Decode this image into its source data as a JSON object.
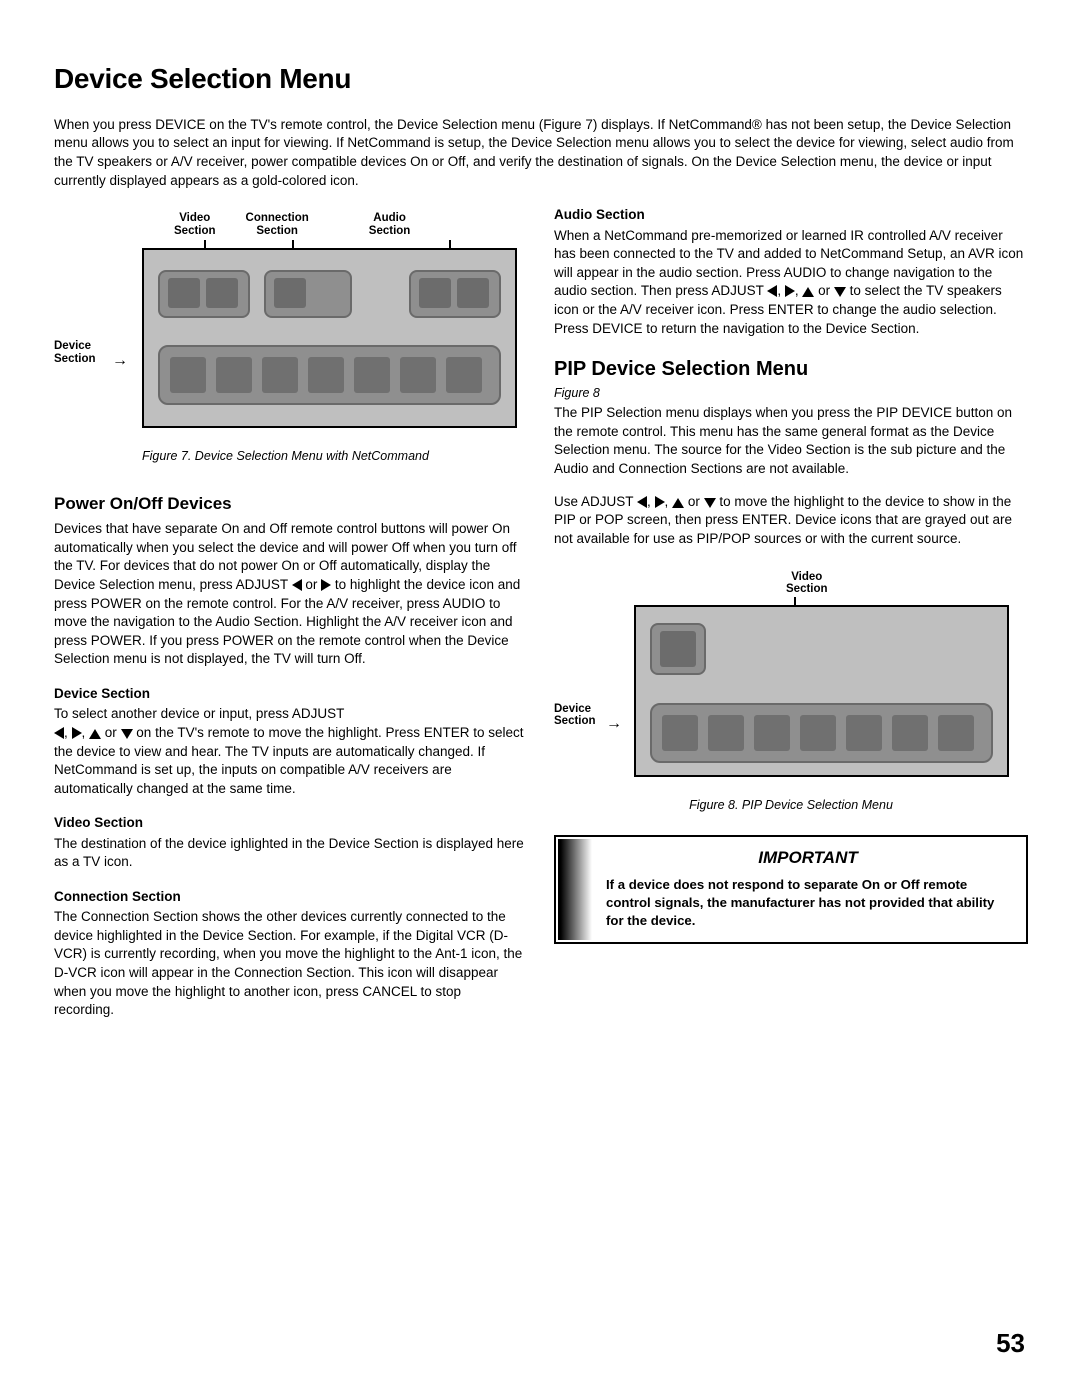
{
  "page_title": "Device Selection Menu",
  "intro": "When you press DEVICE on the TV's remote control, the Device Selection menu (Figure 7) displays.  If NetCommand® has not been setup, the Device Selection menu allows you to select an input for viewing.  If NetCommand is setup, the Device Selection menu allows you to select the device for viewing, select audio from the TV speakers or A/V receiver, power compatible devices On or Off, and verify the destination of signals. On the Device Selection menu, the device or input currently displayed appears as a gold-colored icon.",
  "fig7": {
    "label_video": "Video\nSection",
    "label_conn": "Connection\nSection",
    "label_audio": "Audio\nSection",
    "label_device": "Device\nSection",
    "caption": "Figure 7. Device Selection Menu with NetCommand"
  },
  "left": {
    "power_heading": "Power On/Off Devices",
    "power_body_a": "Devices that have separate On and Off remote control buttons will power On automatically when you select the device and will power Off when you turn off the TV.  For devices that do not power On or Off automatically, display the Device Selection menu, press ADJUST ",
    "power_body_b": " or ",
    "power_body_c": "  to highlight the device icon and press POWER on the remote control.  For the A/V receiver, press AUDIO to move the navigation to the Audio Section.  Highlight the  A/V receiver icon and press POWER.  If you press POWER on the remote control when the Device Selection menu is not displayed, the TV will turn Off.",
    "device_heading": "Device Section",
    "device_body_a": "To select another device or input, press ADJUST ",
    "device_body_b": " on the TV's remote to move the highlight.  Press ENTER to select the device to view and hear.  The TV inputs are automatically changed.  If NetCommand is set up, the inputs on compatible A/V receivers are automatically changed at the same time.",
    "video_heading": "Video Section",
    "video_body": "The destination of the device ighlighted in the Device Section is displayed here as a TV icon.",
    "conn_heading": "Connection Section",
    "conn_body": "The Connection Section shows the other devices currently connected to the device highlighted in the Device Section.  For example, if the Digital VCR (D-VCR) is currently recording, when you move the highlight to the Ant-1 icon, the D-VCR icon will appear in the Connection Section.  This icon will disappear when you move the highlight to another icon, press CANCEL to stop recording."
  },
  "right": {
    "audio_heading": "Audio Section",
    "audio_body_a": "When a NetCommand pre-memorized or learned IR controlled A/V receiver has been connected to the TV and added to NetCommand Setup, an AVR icon will appear in the audio section.  Press AUDIO  to change navigation to the audio section.  Then press ADJUST ",
    "audio_body_b": " to select the TV speakers icon or the A/V receiver icon.  Press ENTER to change the audio selection.  Press DEVICE to return the navigation to the Device Section.",
    "pip_heading": "PIP Device Selection Menu",
    "figure8_ref": "Figure 8",
    "pip_body1": "The PIP Selection menu displays when you press the PIP DEVICE button on the remote control.  This menu has the same general format as the Device Selection menu.  The source for the Video Section is the sub picture and the Audio and Connection Sections are not available.",
    "pip_body2_a": "Use ADJUST ",
    "pip_body2_b": "  to move the highlight to the device to show in the PIP or POP screen, then press ENTER.  Device icons that are grayed out are not available for use as PIP/POP sources or with the current source."
  },
  "fig8": {
    "label_video": "Video\nSection",
    "label_device": "Device\nSection",
    "caption": "Figure 8. PIP Device Selection Menu"
  },
  "important": {
    "title": "IMPORTANT",
    "body": "If a device does not respond to separate On or Off remote control signals, the manufacturer has not provided that ability for the device."
  },
  "page_number": "53",
  "joiners": {
    "comma": ", ",
    "or": " or "
  }
}
